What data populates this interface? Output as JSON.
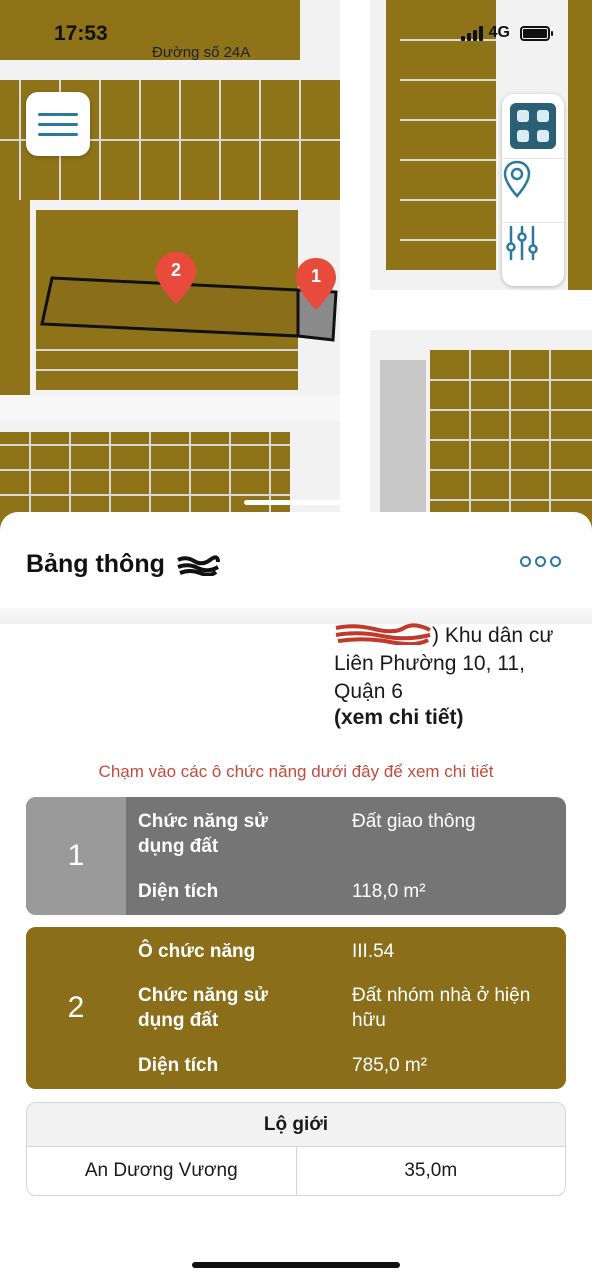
{
  "status_bar": {
    "time": "17:53",
    "network": "4G"
  },
  "map": {
    "street_label": "Đường số 24A",
    "markers": [
      {
        "label": "1"
      },
      {
        "label": "2"
      }
    ],
    "colors": {
      "residential": "#8e7319",
      "traffic": "#8a8a8a",
      "road": "#f2f2f2",
      "lot_line": "#d8d8d8"
    }
  },
  "sheet": {
    "title": "Bảng thông",
    "zone_text": ") Khu dân cư Liên Phường 10, 11, Quận 6",
    "zone_link": "(xem chi tiết)",
    "hint": "Chạm vào các ô chức năng dưới đây để xem chi tiết",
    "cards": [
      {
        "number": "1",
        "color": "#757575",
        "rows": [
          {
            "label": "Chức năng sử dụng đất",
            "value": "Đất giao thông"
          },
          {
            "label": "Diện tích",
            "value": "118,0 m²"
          }
        ]
      },
      {
        "number": "2",
        "color": "#8a6e1a",
        "rows": [
          {
            "label": "Ô chức năng",
            "value": "III.54"
          },
          {
            "label": "Chức năng sử dụng đất",
            "value": "Đất nhóm nhà ở hiện hữu"
          },
          {
            "label": "Diện tích",
            "value": "785,0 m²"
          }
        ]
      }
    ],
    "road_table": {
      "header": "Lộ giới",
      "rows": [
        {
          "name": "An Dương Vương",
          "width": "35,0m"
        }
      ]
    }
  }
}
